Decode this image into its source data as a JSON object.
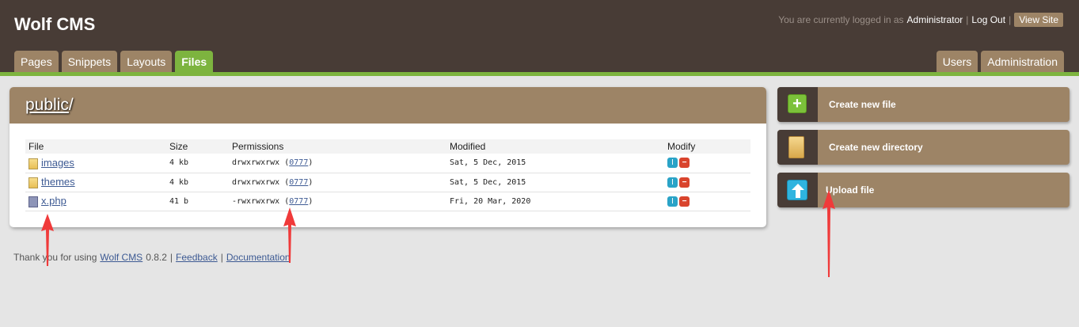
{
  "header": {
    "site_title": "Wolf CMS",
    "logged_in_text": "You are currently logged in as",
    "user": "Administrator",
    "logout": "Log Out",
    "view_site": "View Site",
    "separator": "|"
  },
  "tabs_left": [
    "Pages",
    "Snippets",
    "Layouts",
    "Files"
  ],
  "active_tab": "Files",
  "tabs_right": [
    "Users",
    "Administration"
  ],
  "breadcrumb": {
    "link": "public",
    "slash": "/"
  },
  "table": {
    "headers": [
      "File",
      "Size",
      "Permissions",
      "Modified",
      "Modify"
    ],
    "rows": [
      {
        "name": "images",
        "type": "folder",
        "size": "4 kb",
        "perms": "drwxrwxrwx",
        "octal": "0777",
        "modified": "Sat, 5 Dec, 2015"
      },
      {
        "name": "themes",
        "type": "folder",
        "size": "4 kb",
        "perms": "drwxrwxrwx",
        "octal": "0777",
        "modified": "Sat, 5 Dec, 2015"
      },
      {
        "name": "x.php",
        "type": "file",
        "size": "41 b",
        "perms": "-rwxrwxrwx",
        "octal": "0777",
        "modified": "Fri, 20 Mar, 2020"
      }
    ]
  },
  "actions": {
    "create_file": "Create new file",
    "create_directory": "Create new directory",
    "upload_file": "Upload file"
  },
  "footer": {
    "prefix": "Thank you for using",
    "cms_link": "Wolf CMS",
    "version": "0.8.2",
    "sep": "|",
    "feedback": "Feedback",
    "documentation": "Documentation"
  },
  "colors": {
    "header_bg": "#483c36",
    "tab_bg": "#9d8466",
    "active_tab": "#7db43f",
    "annotation_arrow": "#f03a3a"
  }
}
